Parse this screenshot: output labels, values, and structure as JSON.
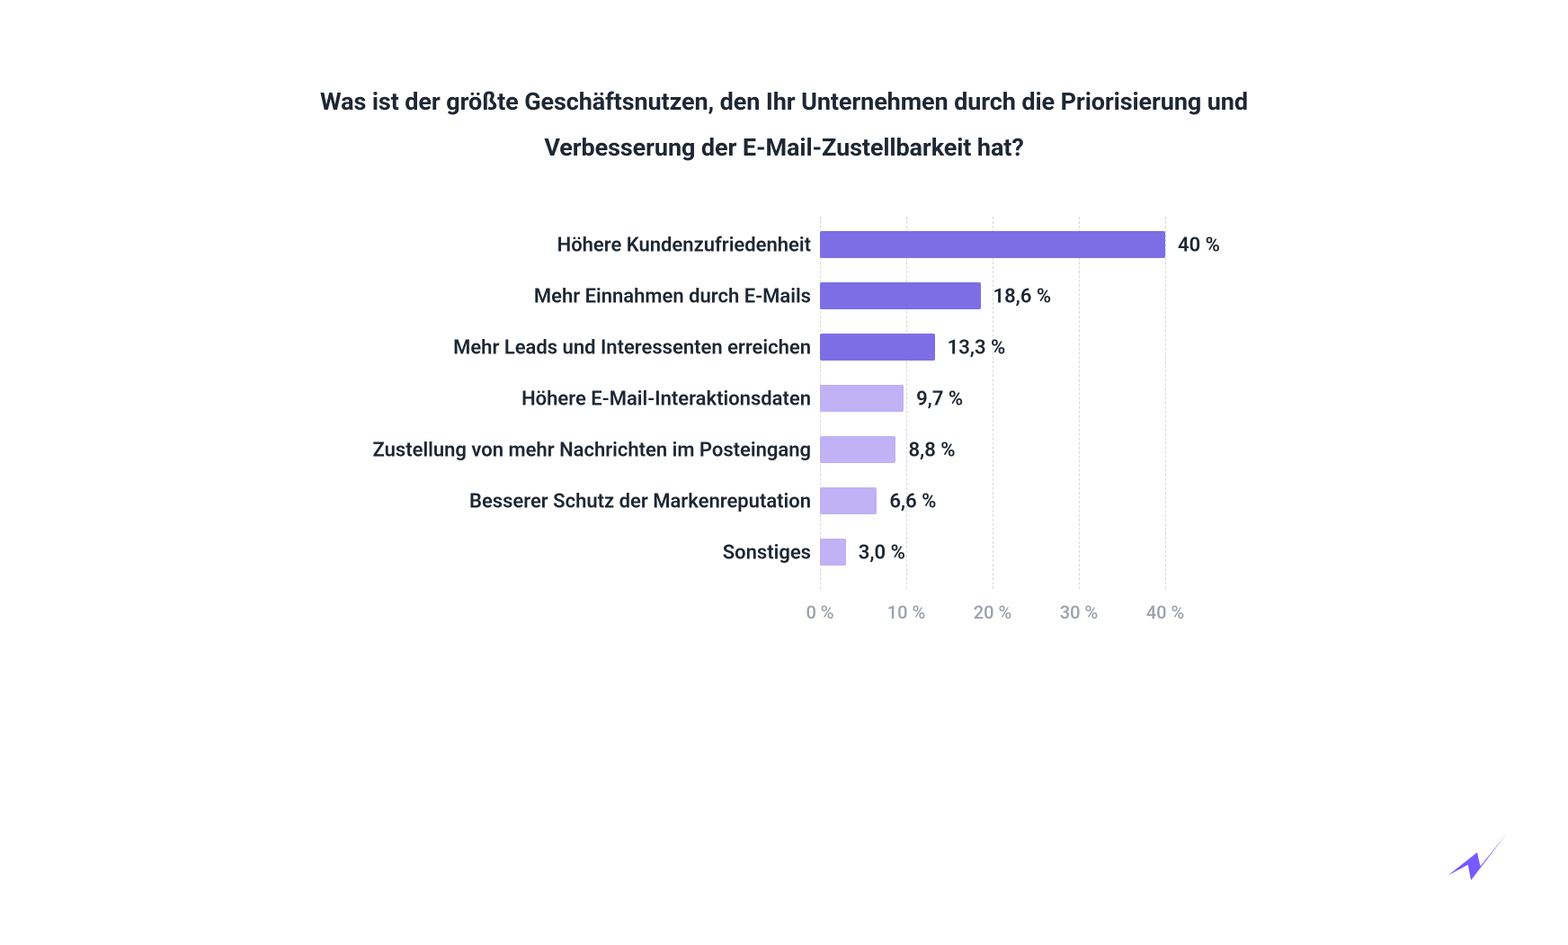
{
  "chart_data": {
    "type": "bar",
    "orientation": "horizontal",
    "title": "Was ist der größte Geschäftsnutzen, den Ihr Unternehmen durch die Priorisierung und Verbesserung der E-Mail-Zustellbarkeit hat?",
    "xlabel": "",
    "ylabel": "",
    "xlim": [
      0,
      50
    ],
    "x_ticks": [
      0,
      10,
      20,
      30,
      40
    ],
    "x_tick_labels": [
      "0 %",
      "10 %",
      "20 %",
      "30 %",
      "40 %"
    ],
    "categories": [
      "Höhere Kundenzufriedenheit",
      "Mehr Einnahmen durch E-Mails",
      "Mehr Leads und Interessenten erreichen",
      "Höhere E-Mail-Interaktionsdaten",
      "Zustellung von mehr Nachrichten im Posteingang",
      "Besserer Schutz der Markenreputation",
      "Sonstiges"
    ],
    "values": [
      40,
      18.6,
      13.3,
      9.7,
      8.8,
      6.6,
      3.0
    ],
    "value_labels": [
      "40 %",
      "18,6 %",
      "13,3 %",
      "9,7 %",
      "8,8 %",
      "6,6 %",
      "3,0 %"
    ],
    "bar_colors": [
      "dark",
      "dark",
      "dark",
      "light",
      "light",
      "light",
      "light"
    ],
    "colors": {
      "dark": "#7d6ee6",
      "light": "#c1b1f5"
    },
    "grid": true
  }
}
